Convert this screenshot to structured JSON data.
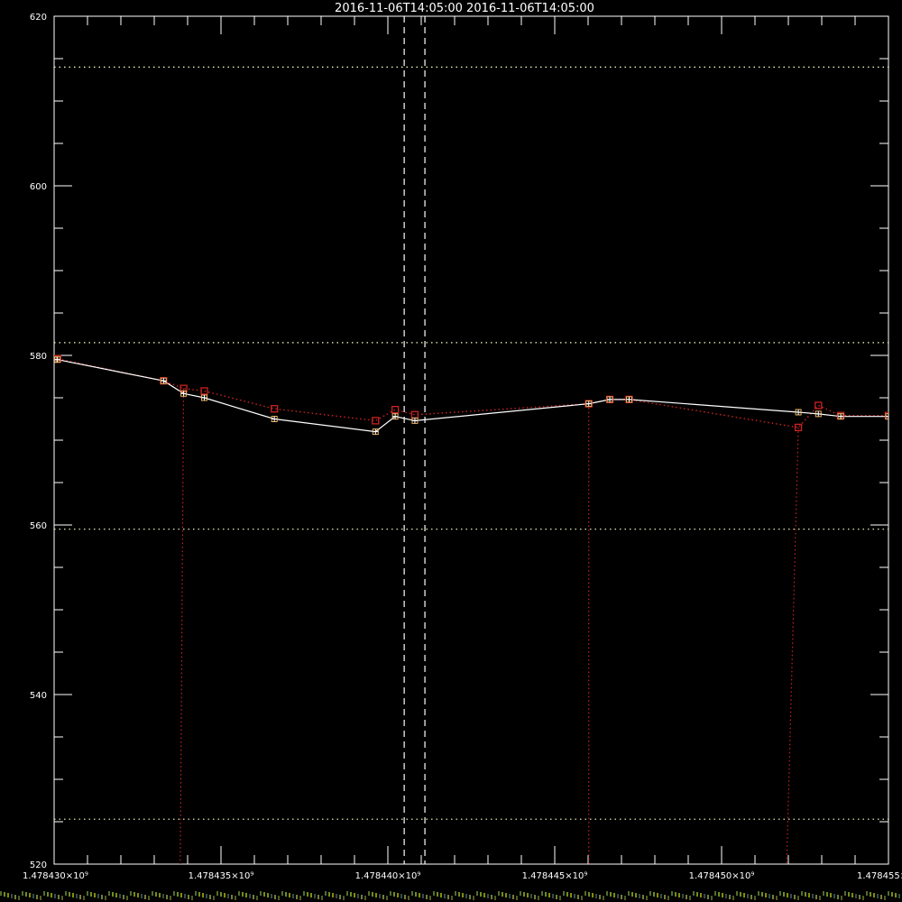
{
  "chart_data": {
    "type": "line",
    "title": "2016-11-06T14:05:00   2016-11-06T14:05:00",
    "xlabel": "",
    "ylabel": "",
    "xlim": [
      1478430000,
      1478455000
    ],
    "ylim": [
      520,
      620
    ],
    "x_tick_labels": [
      {
        "value": 1478430000,
        "label": "1.478430×10⁹"
      },
      {
        "value": 1478435000,
        "label": "1.478435×10⁹"
      },
      {
        "value": 1478440000,
        "label": "1.478440×10⁹"
      },
      {
        "value": 1478445000,
        "label": "1.478445×10⁹"
      },
      {
        "value": 1478450000,
        "label": "1.478450×10⁹"
      },
      {
        "value": 1478455000,
        "label": "1.478455×10⁹"
      }
    ],
    "y_tick_labels": [
      {
        "value": 520,
        "label": "520"
      },
      {
        "value": 540,
        "label": "540"
      },
      {
        "value": 560,
        "label": "560"
      },
      {
        "value": 580,
        "label": "580"
      },
      {
        "value": 600,
        "label": "600"
      },
      {
        "value": 620,
        "label": "620"
      }
    ],
    "y_minor_ticks": [
      525,
      530,
      535,
      545,
      550,
      555,
      565,
      570,
      575,
      585,
      590,
      595,
      605,
      610,
      615
    ],
    "x_minor_ticks": [
      1478431000,
      1478432000,
      1478433000,
      1478434000,
      1478436000,
      1478437000,
      1478438000,
      1478439000,
      1478441000,
      1478442000,
      1478443000,
      1478444000,
      1478446000,
      1478447000,
      1478448000,
      1478449000,
      1478451000,
      1478452000,
      1478453000,
      1478454000
    ],
    "reference_lines_y": [
      614,
      581.5,
      559.5,
      525.3
    ],
    "vertical_markers_x": [
      1478440490,
      1478441110
    ],
    "series": [
      {
        "style": "solid",
        "color": "#ffffff",
        "marker": "plus",
        "x": [
          1478430000,
          1478430100,
          1478433280,
          1478433880,
          1478434500,
          1478436600,
          1478439630,
          1478440220,
          1478440810,
          1478446020,
          1478446650,
          1478447230,
          1478452300,
          1478452900,
          1478453570,
          1478455000
        ],
        "y": [
          579.5,
          579.5,
          577.0,
          575.5,
          575.0,
          572.5,
          571.0,
          572.8,
          572.3,
          574.3,
          574.8,
          574.8,
          573.3,
          573.1,
          572.8,
          572.8
        ]
      },
      {
        "style": "dotted",
        "color": "#cc2222",
        "marker": "square",
        "x": [
          1478430000,
          1478430100,
          1478433280,
          1478433880,
          1478434500,
          1478436600,
          1478439630,
          1478440220,
          1478440810,
          1478446020,
          1478446650,
          1478447230,
          1478452300,
          1478452900,
          1478453570,
          1478455000
        ],
        "y": [
          579.6,
          579.6,
          577.0,
          576.1,
          575.8,
          573.7,
          572.3,
          573.6,
          573.0,
          574.3,
          574.8,
          574.8,
          571.5,
          574.1,
          572.9,
          572.9
        ]
      }
    ],
    "dropouts": [
      {
        "x_top": 1478433880,
        "x_bottom": 1478433780,
        "y_top": 576.1
      },
      {
        "x_top": 1478446020,
        "x_bottom": 1478446020,
        "y_top": 574.3
      },
      {
        "x_top": 1478452300,
        "x_bottom": 1478451950,
        "y_top": 571.5
      }
    ],
    "grid": false,
    "legend": "none"
  },
  "colors": {
    "background": "#000000",
    "axes": "#ffffff",
    "primary_series": "#ffffff",
    "secondary_series": "#cc2222",
    "reference_lines": "#ffffcc",
    "marker_fill": "#e8b060"
  }
}
